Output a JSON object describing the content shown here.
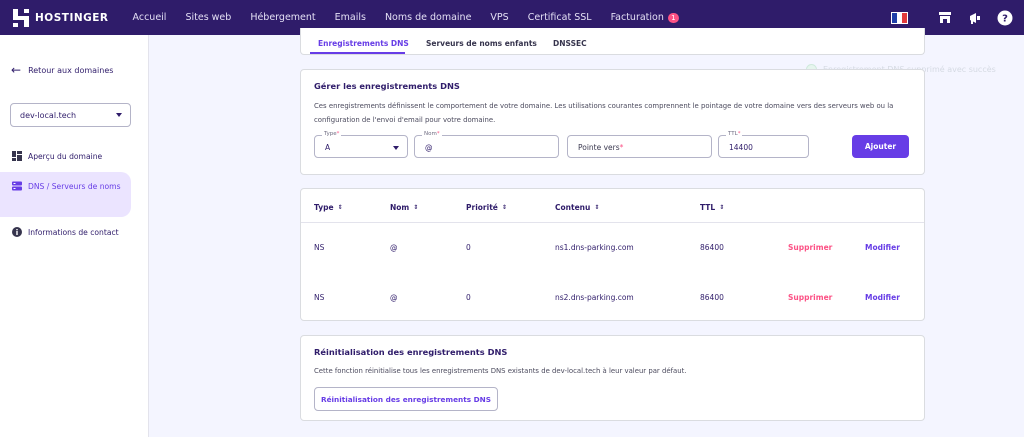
{
  "topbar": {
    "brand": "HOSTINGER",
    "nav": [
      "Accueil",
      "Sites web",
      "Hébergement",
      "Emails",
      "Noms de domaine",
      "VPS",
      "Certificat SSL",
      "Facturation"
    ],
    "billing_badge": "1",
    "icons": [
      "france-flag-icon",
      "store-icon",
      "megaphone-icon",
      "help-icon"
    ],
    "colors": {
      "bar": "#2f1c6a",
      "badge": "#fc5185"
    }
  },
  "sidebar": {
    "back_label": "Retour aux domaines",
    "domain_select": "dev-local.tech",
    "items": [
      {
        "label": "Aperçu du domaine",
        "icon": "grid-icon"
      },
      {
        "label": "DNS / Serveurs de noms",
        "icon": "server-icon",
        "active": true
      },
      {
        "label": "Informations de contact",
        "icon": "info-icon"
      }
    ]
  },
  "tabs": [
    "Enregistrements DNS",
    "Serveurs de noms enfants",
    "DNSSEC"
  ],
  "toast": "Enregistrement DNS supprimé avec succès",
  "manage": {
    "title": "Gérer les enregistrements DNS",
    "description": "Ces enregistrements définissent le comportement de votre domaine. Les utilisations courantes comprennent le pointage de votre domaine vers des serveurs web ou la configuration de l'envoi d'email pour votre domaine.",
    "type_label": "Type",
    "type_value": "A",
    "name_label": "Nom",
    "name_value": "@",
    "points_to_placeholder": "Pointe vers",
    "ttl_label": "TTL",
    "ttl_value": "14400",
    "add_button": "Ajouter"
  },
  "table": {
    "headers": [
      "Type",
      "Nom",
      "Priorité",
      "Contenu",
      "TTL"
    ],
    "rows": [
      {
        "type": "NS",
        "name": "@",
        "priority": "0",
        "content": "ns1.dns-parking.com",
        "ttl": "86400",
        "delete": "Supprimer",
        "edit": "Modifier"
      },
      {
        "type": "NS",
        "name": "@",
        "priority": "0",
        "content": "ns2.dns-parking.com",
        "ttl": "86400",
        "delete": "Supprimer",
        "edit": "Modifier"
      }
    ]
  },
  "reset": {
    "title": "Réinitialisation des enregistrements DNS",
    "description": "Cette fonction réinitialise tous les enregistrements DNS existants de dev-local.tech à leur valeur par défaut.",
    "button": "Réinitialisation des enregistrements DNS"
  }
}
